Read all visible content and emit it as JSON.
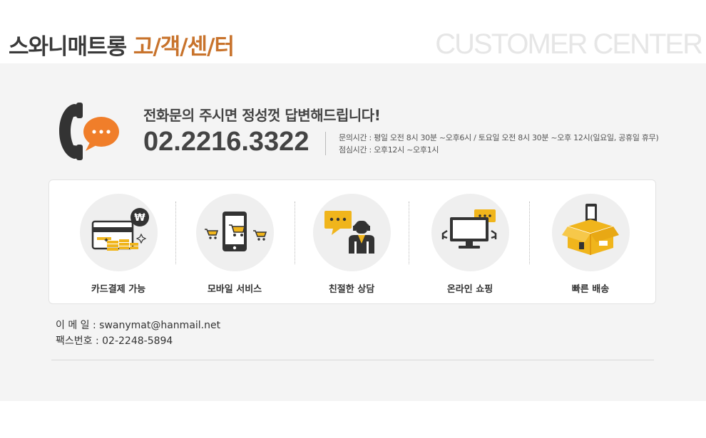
{
  "header": {
    "title_main": "스와니매트롱",
    "title_accent": "고/객/센/터",
    "title_en": "CUSTOMER CENTER"
  },
  "call": {
    "slogan": "전화문의 주시면 정성껏 답변해드립니다!",
    "phone_number": "02.2216.3322",
    "hours_line1": "문의시간 : 평일 오전 8시 30분 ~오후6시 / 토요일 오전 8시 30분 ~오후 12시(일요일, 공휴일 휴무)",
    "hours_line2": "점심시간 : 오후12시 ~오후1시"
  },
  "services": [
    {
      "label": "카드결제 가능",
      "icon": "card-coins-icon"
    },
    {
      "label": "모바일 서비스",
      "icon": "mobile-cart-icon"
    },
    {
      "label": "친절한 상담",
      "icon": "counselor-icon"
    },
    {
      "label": "온라인 쇼핑",
      "icon": "monitor-icon"
    },
    {
      "label": "빠른 배송",
      "icon": "delivery-box-icon"
    }
  ],
  "contact": {
    "email_label": "이 메 일 :",
    "email": "swanymat@hanmail.net",
    "fax_label": "팩스번호 :",
    "fax": "02-2248-5894"
  },
  "colors": {
    "accent": "#c8732c",
    "orange": "#f07e2a",
    "yellow": "#f0b51c",
    "dark": "#333333"
  }
}
